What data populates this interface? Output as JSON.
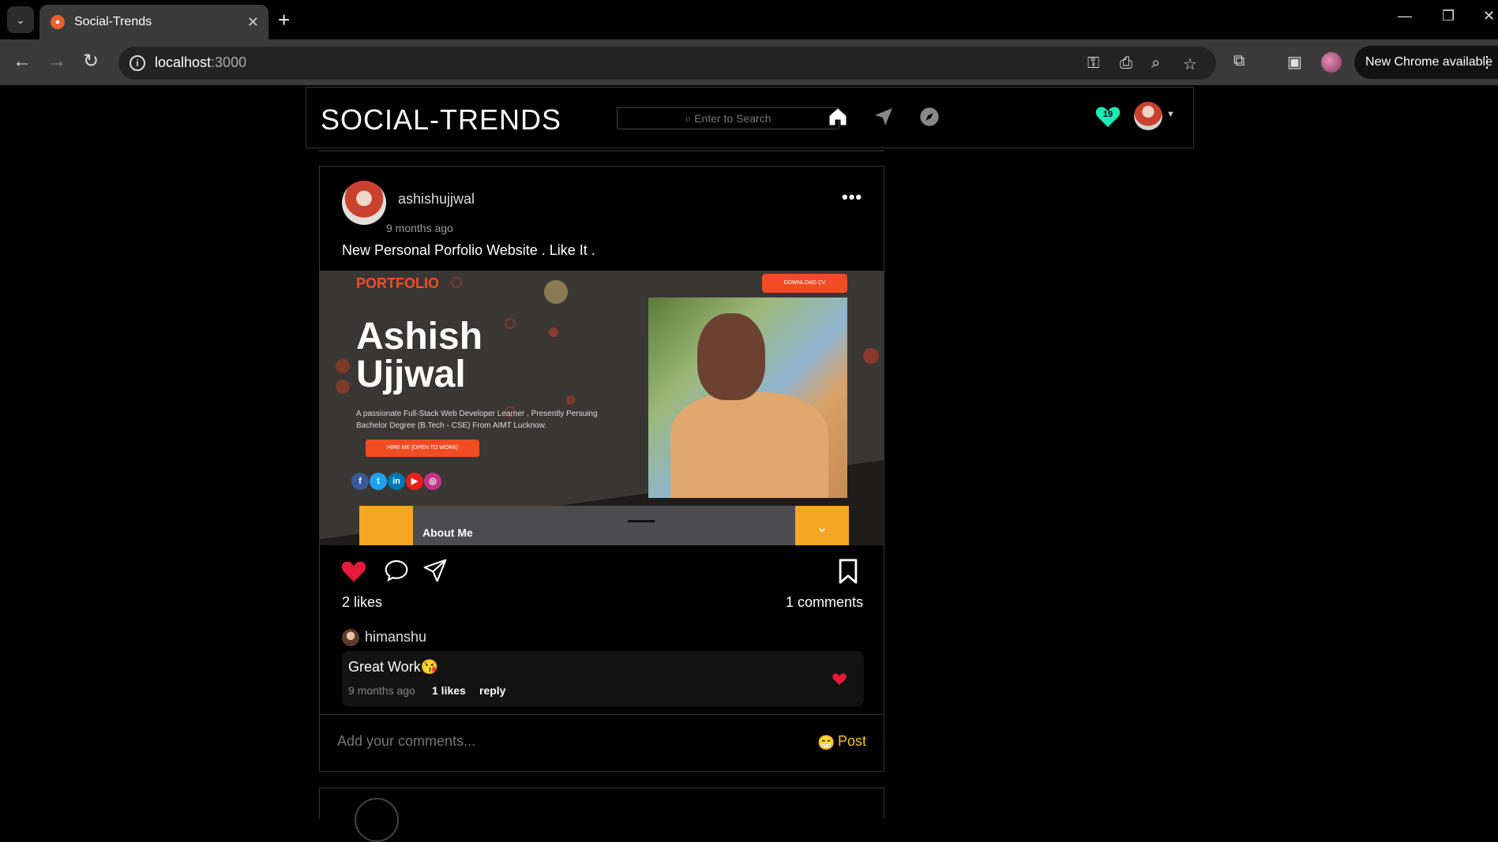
{
  "browser": {
    "tab_title": "Social-Trends",
    "url_host": "localhost",
    "url_port": ":3000",
    "update_button": "New Chrome available"
  },
  "app": {
    "brand": "SOCIAL-TRENDS",
    "search_placeholder": "Enter to Search",
    "notification_count": "19",
    "accent_teal": "#1de9b6",
    "accent_yellow": "#f6c90e",
    "like_red": "#e8193c"
  },
  "post": {
    "username": "ashishujjwal",
    "time": "9 months ago",
    "caption": "New Personal Porfolio Website . Like It .",
    "image": {
      "logo_prefix": "P",
      "logo_rest": "ORTFOLIO",
      "name_line1": "Ashish",
      "name_line2": "Ujjwal",
      "description": "A passionate Full-Stack Web Developer Learner , Presently Persuing Bachelor Degree (B.Tech - CSE) From AIMT Lucknow.",
      "hire_button": "HIRE ME [OPEN TO WORK]",
      "cv_button": "DOWNLOAD CV",
      "about_label": "About Me",
      "social_icons": [
        "f",
        "t",
        "in",
        "▶",
        "◎"
      ]
    },
    "likes": "2 likes",
    "comments_count": "1 comments",
    "comment": {
      "user": "himanshu",
      "text": "Great Work😘",
      "time": "9 months ago",
      "likes": "1 likes",
      "reply": "reply"
    },
    "add_comment_placeholder": "Add your comments...",
    "post_button": "Post"
  }
}
